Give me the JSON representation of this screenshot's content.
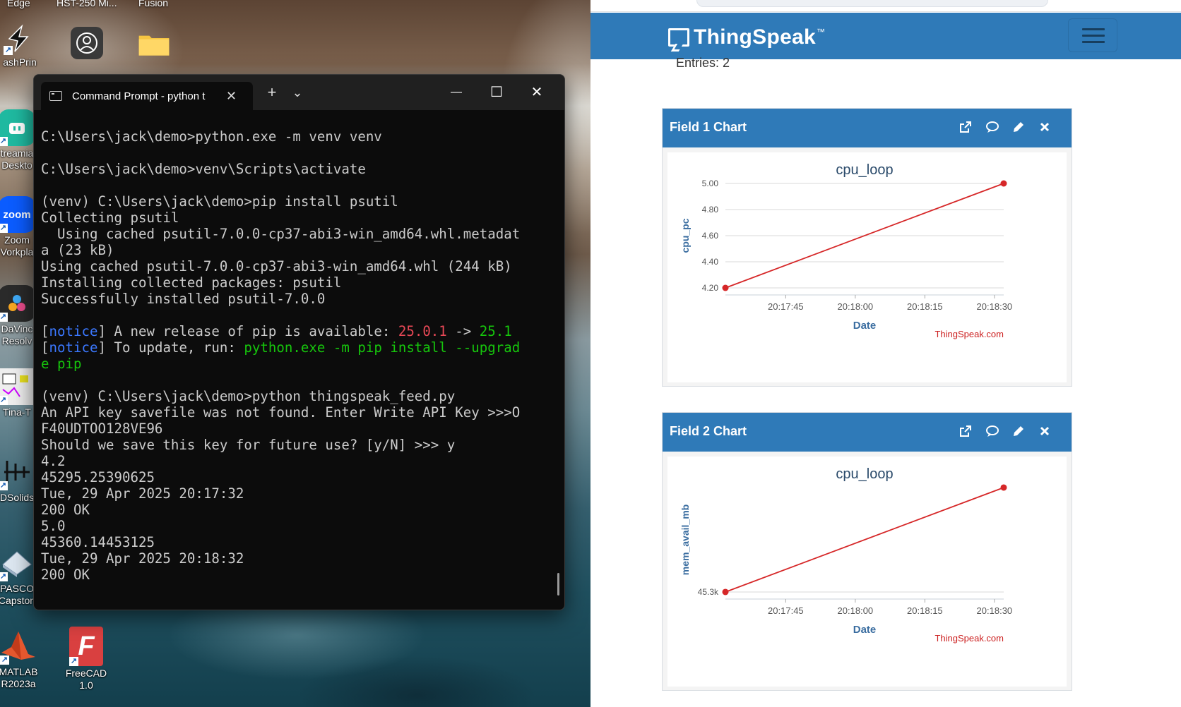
{
  "desktop": {
    "top_labels": [
      "Edge",
      "HST-250 Mi...",
      "Fusion"
    ],
    "icons": [
      {
        "label": "ashPrin",
        "color": "#1e1e1e"
      },
      {
        "label": "treamia\nDeskto",
        "color": "#1fb9a0"
      },
      {
        "label": "Zoom\nVorkpla",
        "color": "#0b5cff",
        "text": "zoom"
      },
      {
        "label": "DaVinc\nResolv",
        "color": "#2a2a2a"
      },
      {
        "label": "Tina-T",
        "color": "#dddddd"
      },
      {
        "label": "DSolids",
        "color": "#dddddd"
      },
      {
        "label": "PASCO\nCapston",
        "color": "#c9d6e4"
      },
      {
        "label": "MATLAB\nR2023a",
        "color": "#e4572e"
      },
      {
        "label": "FreeCAD 1.0",
        "color": "#d94040",
        "text": "F"
      }
    ]
  },
  "terminal": {
    "tab_title": "Command Prompt - python  t",
    "new_tab": "+",
    "dropdown": "⌄",
    "minimize": "—",
    "maximize": "☐",
    "close": "✕",
    "lines": [
      [
        {
          "t": "C:\\Users\\jack\\demo>python.exe -m venv venv"
        }
      ],
      [],
      [
        {
          "t": "C:\\Users\\jack\\demo>venv\\Scripts\\activate"
        }
      ],
      [],
      [
        {
          "t": "(venv) C:\\Users\\jack\\demo>pip install psutil"
        }
      ],
      [
        {
          "t": "Collecting psutil"
        }
      ],
      [
        {
          "t": "  Using cached psutil-7.0.0-cp37-abi3-win_amd64.whl.metadat"
        }
      ],
      [
        {
          "t": "a (23 kB)"
        }
      ],
      [
        {
          "t": "Using cached psutil-7.0.0-cp37-abi3-win_amd64.whl (244 kB)"
        }
      ],
      [
        {
          "t": "Installing collected packages: psutil"
        }
      ],
      [
        {
          "t": "Successfully installed psutil-7.0.0"
        }
      ],
      [],
      [
        {
          "t": "["
        },
        {
          "t": "notice",
          "c": "blue"
        },
        {
          "t": "] A new release of pip is available: "
        },
        {
          "t": "25.0.1",
          "c": "red"
        },
        {
          "t": " -> "
        },
        {
          "t": "25.1",
          "c": "green"
        }
      ],
      [
        {
          "t": "["
        },
        {
          "t": "notice",
          "c": "blue"
        },
        {
          "t": "] To update, run: "
        },
        {
          "t": "python.exe -m pip install --upgrad",
          "c": "green"
        }
      ],
      [
        {
          "t": "e pip",
          "c": "green"
        }
      ],
      [],
      [
        {
          "t": "(venv) C:\\Users\\jack\\demo>python thingspeak_feed.py"
        }
      ],
      [
        {
          "t": "An API key savefile was not found. Enter Write API Key >>>O"
        }
      ],
      [
        {
          "t": "F40UDTOO128VE96"
        }
      ],
      [
        {
          "t": "Should we save this key for future use? [y/N] >>> y"
        }
      ],
      [
        {
          "t": "4.2"
        }
      ],
      [
        {
          "t": "45295.25390625"
        }
      ],
      [
        {
          "t": "Tue, 29 Apr 2025 20:17:32"
        }
      ],
      [
        {
          "t": "200 OK"
        }
      ],
      [
        {
          "t": "5.0"
        }
      ],
      [
        {
          "t": "45360.14453125"
        }
      ],
      [
        {
          "t": "Tue, 29 Apr 2025 20:18:32"
        }
      ],
      [
        {
          "t": "200 OK"
        }
      ]
    ]
  },
  "browser": {
    "logo_text": "ThingSpeak",
    "logo_tm": "™",
    "entries": "Entries: 2"
  },
  "panels": [
    {
      "title": "Field 1 Chart"
    },
    {
      "title": "Field 2 Chart"
    }
  ],
  "colors": {
    "thingspeak_blue": "#2f7ab8",
    "series_red": "#d62728",
    "terminal_bg": "#0c0c0c"
  },
  "chart_data": [
    {
      "type": "line",
      "title": "cpu_loop",
      "xlabel": "Date",
      "ylabel": "cpu_pc",
      "credit": "ThingSpeak.com",
      "x_ticks": [
        "20:17:45",
        "20:18:00",
        "20:18:15",
        "20:18:30"
      ],
      "x_tick_seconds": [
        45,
        60,
        75,
        90
      ],
      "xlim_seconds": [
        32,
        92
      ],
      "y_ticks": [
        "4.20",
        "4.40",
        "4.60",
        "4.80",
        "5.00"
      ],
      "y_tick_values": [
        4.2,
        4.4,
        4.6,
        4.8,
        5.0
      ],
      "ylim": [
        4.2,
        5.0
      ],
      "series": [
        {
          "x": [
            "20:17:32",
            "20:18:32"
          ],
          "x_seconds": [
            32,
            92
          ],
          "values": [
            4.2,
            5.0
          ]
        }
      ]
    },
    {
      "type": "line",
      "title": "cpu_loop",
      "xlabel": "Date",
      "ylabel": "mem_avail_mb",
      "credit": "ThingSpeak.com",
      "x_ticks": [
        "20:17:45",
        "20:18:00",
        "20:18:15",
        "20:18:30"
      ],
      "x_tick_seconds": [
        45,
        60,
        75,
        90
      ],
      "xlim_seconds": [
        32,
        92
      ],
      "y_ticks": [
        "45.3k"
      ],
      "y_tick_values": [
        45295.25
      ],
      "ylim": [
        45295.25,
        45360.14
      ],
      "series": [
        {
          "x": [
            "20:17:32",
            "20:18:32"
          ],
          "x_seconds": [
            32,
            92
          ],
          "values": [
            45295.25390625,
            45360.14453125
          ]
        }
      ]
    }
  ]
}
